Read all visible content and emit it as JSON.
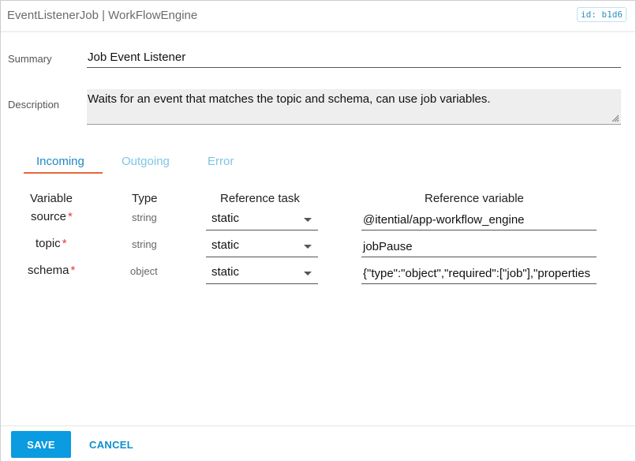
{
  "header": {
    "title": "EventListenerJob | WorkFlowEngine",
    "id_badge": "id: b1d6"
  },
  "form": {
    "summary_label": "Summary",
    "summary_value": "Job Event Listener",
    "description_label": "Description",
    "description_value": "Waits for an event that matches the topic and schema, can use job variables."
  },
  "tabs": [
    {
      "label": "Incoming",
      "active": true
    },
    {
      "label": "Outgoing",
      "active": false
    },
    {
      "label": "Error",
      "active": false
    }
  ],
  "table": {
    "headers": {
      "variable": "Variable",
      "type": "Type",
      "reference_task": "Reference task",
      "reference_variable": "Reference variable"
    },
    "rows": [
      {
        "variable": "source",
        "required": "*",
        "type": "string",
        "reference_task": "static",
        "reference_variable": "@itential/app-workflow_engine"
      },
      {
        "variable": "topic",
        "required": "*",
        "type": "string",
        "reference_task": "static",
        "reference_variable": "jobPause"
      },
      {
        "variable": "schema",
        "required": "*",
        "type": "object",
        "reference_task": "static",
        "reference_variable": "{\"type\":\"object\",\"required\":[\"job\"],\"properties"
      }
    ]
  },
  "footer": {
    "save_label": "SAVE",
    "cancel_label": "CANCEL"
  },
  "colors": {
    "accent": "#0a9be0",
    "tab_active": "#1e88c7",
    "tab_underline": "#e8663a",
    "required": "#e53935"
  },
  "icons": {
    "dropdown": "caret-down-icon",
    "resize": "resize-grip-icon"
  }
}
